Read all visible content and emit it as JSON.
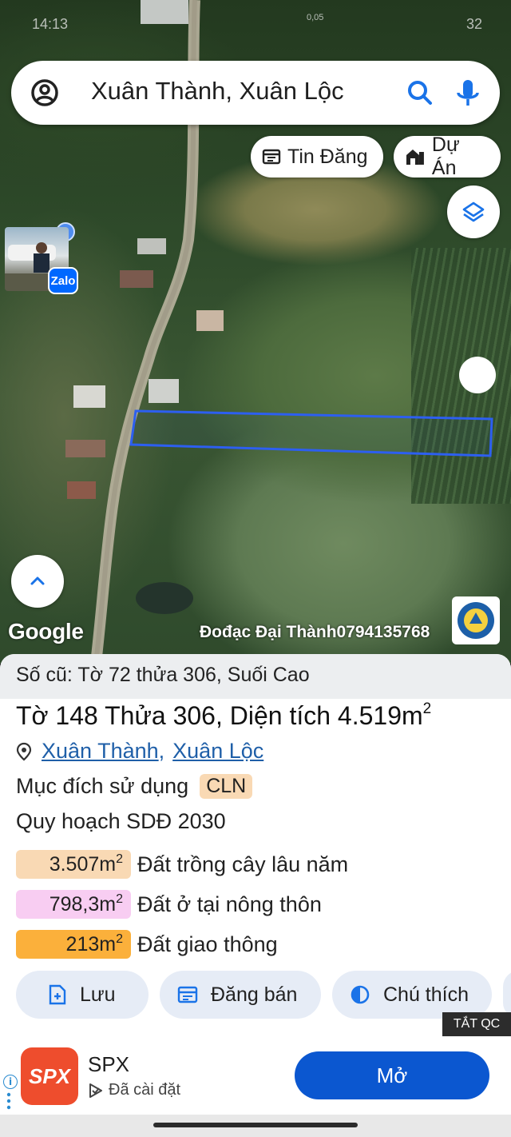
{
  "status_bar": {
    "time": "14:13",
    "network_speed": "0,05",
    "battery": "32"
  },
  "search": {
    "query": "Xuân Thành, Xuân Lộc"
  },
  "chips": [
    {
      "label": "Tin Đăng",
      "icon": "listing-icon"
    },
    {
      "label": "Dự Án",
      "icon": "project-icon"
    }
  ],
  "map": {
    "zalo_label": "Zalo",
    "google_logo": "Google",
    "watermark": "Đođạc Đại Thành0794135768"
  },
  "parcel": {
    "old_reference": "Số cũ: Tờ 72 thửa 306, Suối Cao",
    "title": "Tờ 148 Thửa 306, Diện tích 4.519m",
    "title_sup": "2",
    "location_commune": "Xuân Thành",
    "location_separator": ",",
    "location_district": "Xuân Lộc",
    "purpose_label": "Mục đích sử dụng",
    "purpose_code": "CLN",
    "plan_label": "Quy hoạch SDĐ 2030",
    "zones": [
      {
        "area": "3.507m",
        "sup": "2",
        "label": "Đất trồng cây lâu năm",
        "color": "#f9d9b4"
      },
      {
        "area": "798,3m",
        "sup": "2",
        "label": "Đất ở tại nông thôn",
        "color": "#f8cdf2"
      },
      {
        "area": "213m",
        "sup": "2",
        "label": "Đất giao thông",
        "color": "#fbb03b"
      }
    ]
  },
  "actions": {
    "save": "Lưu",
    "post_sale": "Đăng bán",
    "legend": "Chú thích"
  },
  "ad": {
    "close_label": "TẮT QC",
    "app_icon_text": "SPX",
    "app_name": "SPX",
    "installed": "Đã cài đặt",
    "open_label": "Mở",
    "accent": "#0b57d0"
  },
  "colors": {
    "parcel_outline": "#2d5ff0",
    "link": "#1f5fa8"
  }
}
